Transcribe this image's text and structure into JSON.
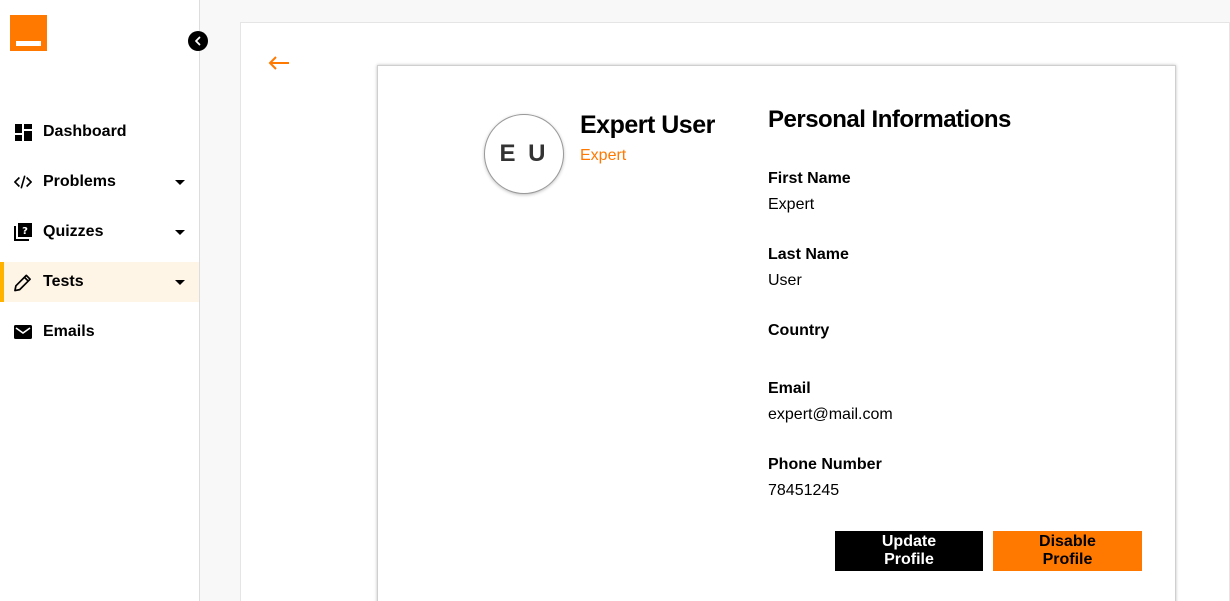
{
  "sidebar": {
    "items": [
      {
        "label": "Dashboard",
        "icon": "dashboard-icon"
      },
      {
        "label": "Problems",
        "icon": "code-icon"
      },
      {
        "label": "Quizzes",
        "icon": "quiz-icon"
      },
      {
        "label": "Tests",
        "icon": "pencil-icon"
      },
      {
        "label": "Emails",
        "icon": "mail-icon"
      }
    ],
    "active_item": "Tests"
  },
  "profile": {
    "initials": "E U",
    "name": "Expert User",
    "role": "Expert"
  },
  "personal": {
    "title": "Personal Informations",
    "fields": [
      {
        "label": "First Name",
        "value": "Expert"
      },
      {
        "label": "Last Name",
        "value": "User"
      },
      {
        "label": "Country",
        "value": ""
      },
      {
        "label": "Email",
        "value": "expert@mail.com"
      },
      {
        "label": "Phone Number",
        "value": "78451245"
      }
    ]
  },
  "actions": {
    "update_label": "Update Profile",
    "disable_label": "Disable Profile"
  },
  "colors": {
    "brand": "#ff7900",
    "active_bg": "#fff5e6",
    "active_indicator": "#ffb300"
  }
}
